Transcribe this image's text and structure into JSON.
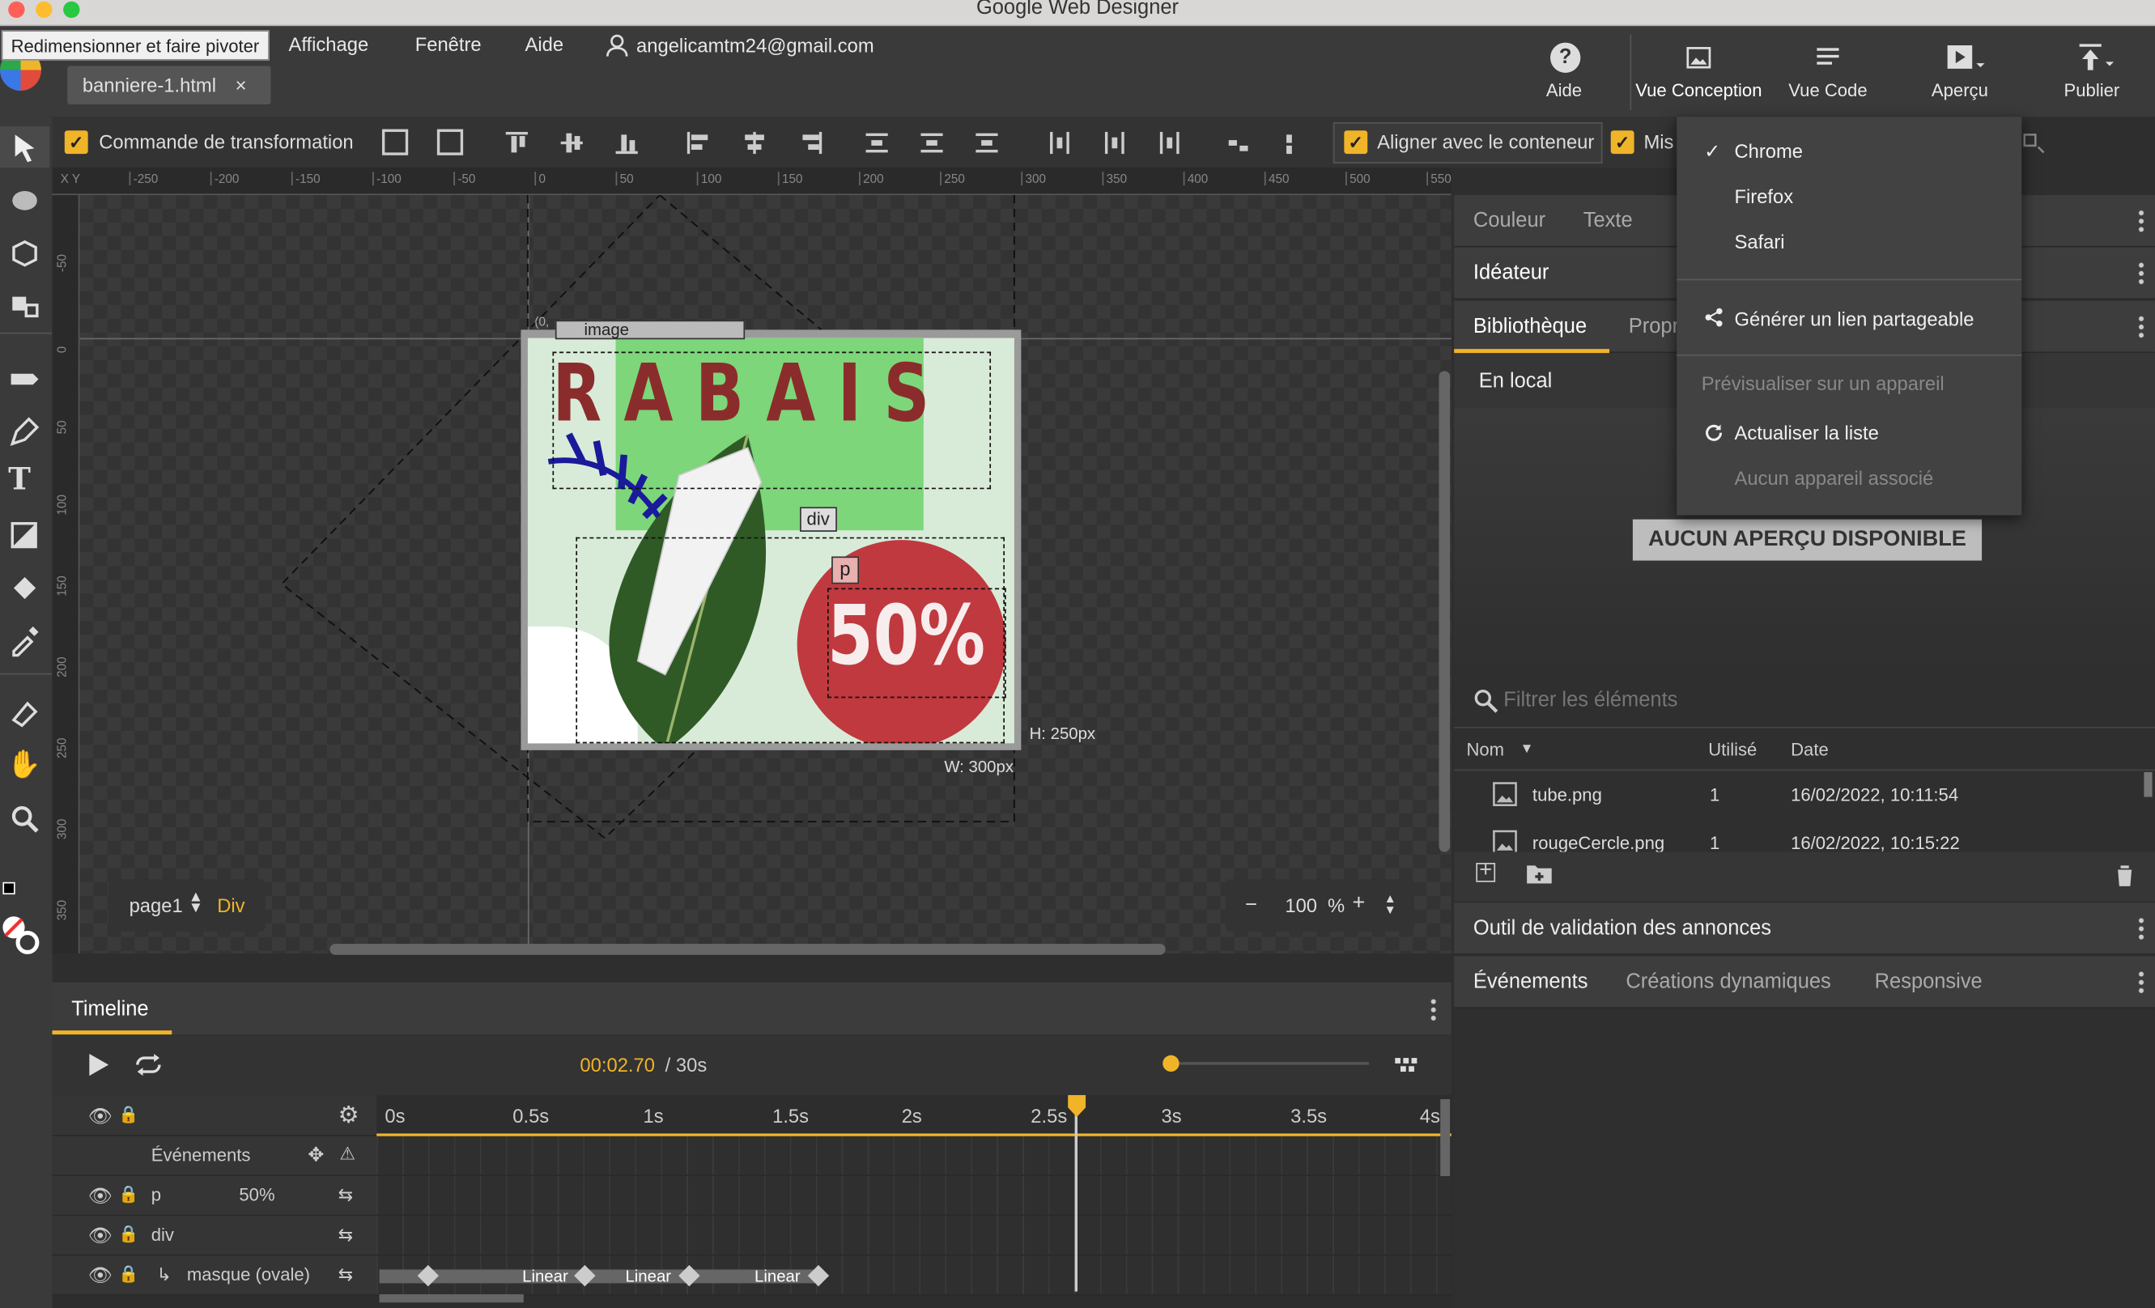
{
  "window": {
    "title": "Google Web Designer"
  },
  "tooltip": "Redimensionner et faire pivoter",
  "menu": {
    "view": "Affichage",
    "window": "Fenêtre",
    "help": "Aide",
    "account": "angelicamtm24@gmail.com"
  },
  "doc_tab": {
    "name": "banniere-1.html",
    "close": "×"
  },
  "header_buttons": {
    "help": "Aide",
    "design_view": "Vue Conception",
    "code_view": "Vue Code",
    "preview": "Aperçu",
    "publish": "Publier"
  },
  "toolbar": {
    "transform_label": "Commande de transformation",
    "align_container_label": "Aligner avec le conteneur",
    "truncated_label": "Mis"
  },
  "ruler_top": [
    "-250",
    "-200",
    "-150",
    "-100",
    "-50",
    "0",
    "50",
    "100",
    "150",
    "200",
    "250",
    "300",
    "350",
    "400",
    "450",
    "500",
    "550"
  ],
  "ruler_left": [
    "-50",
    "0",
    "50",
    "100",
    "150",
    "200",
    "250",
    "300",
    "350"
  ],
  "ruler_corner": "X Y",
  "canvas": {
    "ad_title": "R A B A I S",
    "ad_percent": "50%",
    "label_div": "div",
    "label_p": "p",
    "label_image": "image",
    "label_coord": "(0,",
    "height_label": "H: 250px",
    "width_label": "W: 300px",
    "page_select": "page1",
    "element_type": "Div",
    "zoom_minus": "−",
    "zoom_value": "100",
    "zoom_unit": "%",
    "zoom_plus": "+"
  },
  "timeline": {
    "title": "Timeline",
    "current_time": "00:02.70",
    "duration": "/ 30s",
    "ticks": [
      "0s",
      "0.5s",
      "1s",
      "1.5s",
      "2s",
      "2.5s",
      "3s",
      "3.5s",
      "4s"
    ],
    "rows": [
      {
        "label": "Événements",
        "value": ""
      },
      {
        "label": "p",
        "value": "50%"
      },
      {
        "label": "div",
        "value": ""
      },
      {
        "label": "masque (ovale)",
        "value": ""
      }
    ],
    "easing_labels": [
      "Linear",
      "Linear",
      "Linear"
    ]
  },
  "right_panel": {
    "tabs_color": [
      "Couleur",
      "Texte"
    ],
    "ideator": "Idéateur",
    "library_tabs": [
      "Bibliothèque",
      "Propr"
    ],
    "local": "En local",
    "no_preview": "AUCUN APERÇU DISPONIBLE",
    "filter_placeholder": "Filtrer les éléments",
    "columns": {
      "name": "Nom",
      "used": "Utilisé",
      "date": "Date"
    },
    "files": [
      {
        "name": "tube.png",
        "used": "1",
        "date": "16/02/2022, 10:11:54"
      },
      {
        "name": "rougeCercle.png",
        "used": "1",
        "date": "16/02/2022, 10:15:22"
      }
    ],
    "validator": "Outil de validation des annonces",
    "bottom_tabs": [
      "Événements",
      "Créations dynamiques",
      "Responsive"
    ]
  },
  "preview_menu": {
    "browsers": [
      "Chrome",
      "Firefox",
      "Safari"
    ],
    "selected": "Chrome",
    "share": "Générer un lien partageable",
    "preview_device": "Prévisualiser sur un appareil",
    "refresh": "Actualiser la liste",
    "no_device": "Aucun appareil associé"
  },
  "colors": {
    "accent": "#f0b429",
    "ad_red": "#c0393f",
    "ad_title": "#8b2c2c",
    "ad_green": "#7dd67a"
  }
}
